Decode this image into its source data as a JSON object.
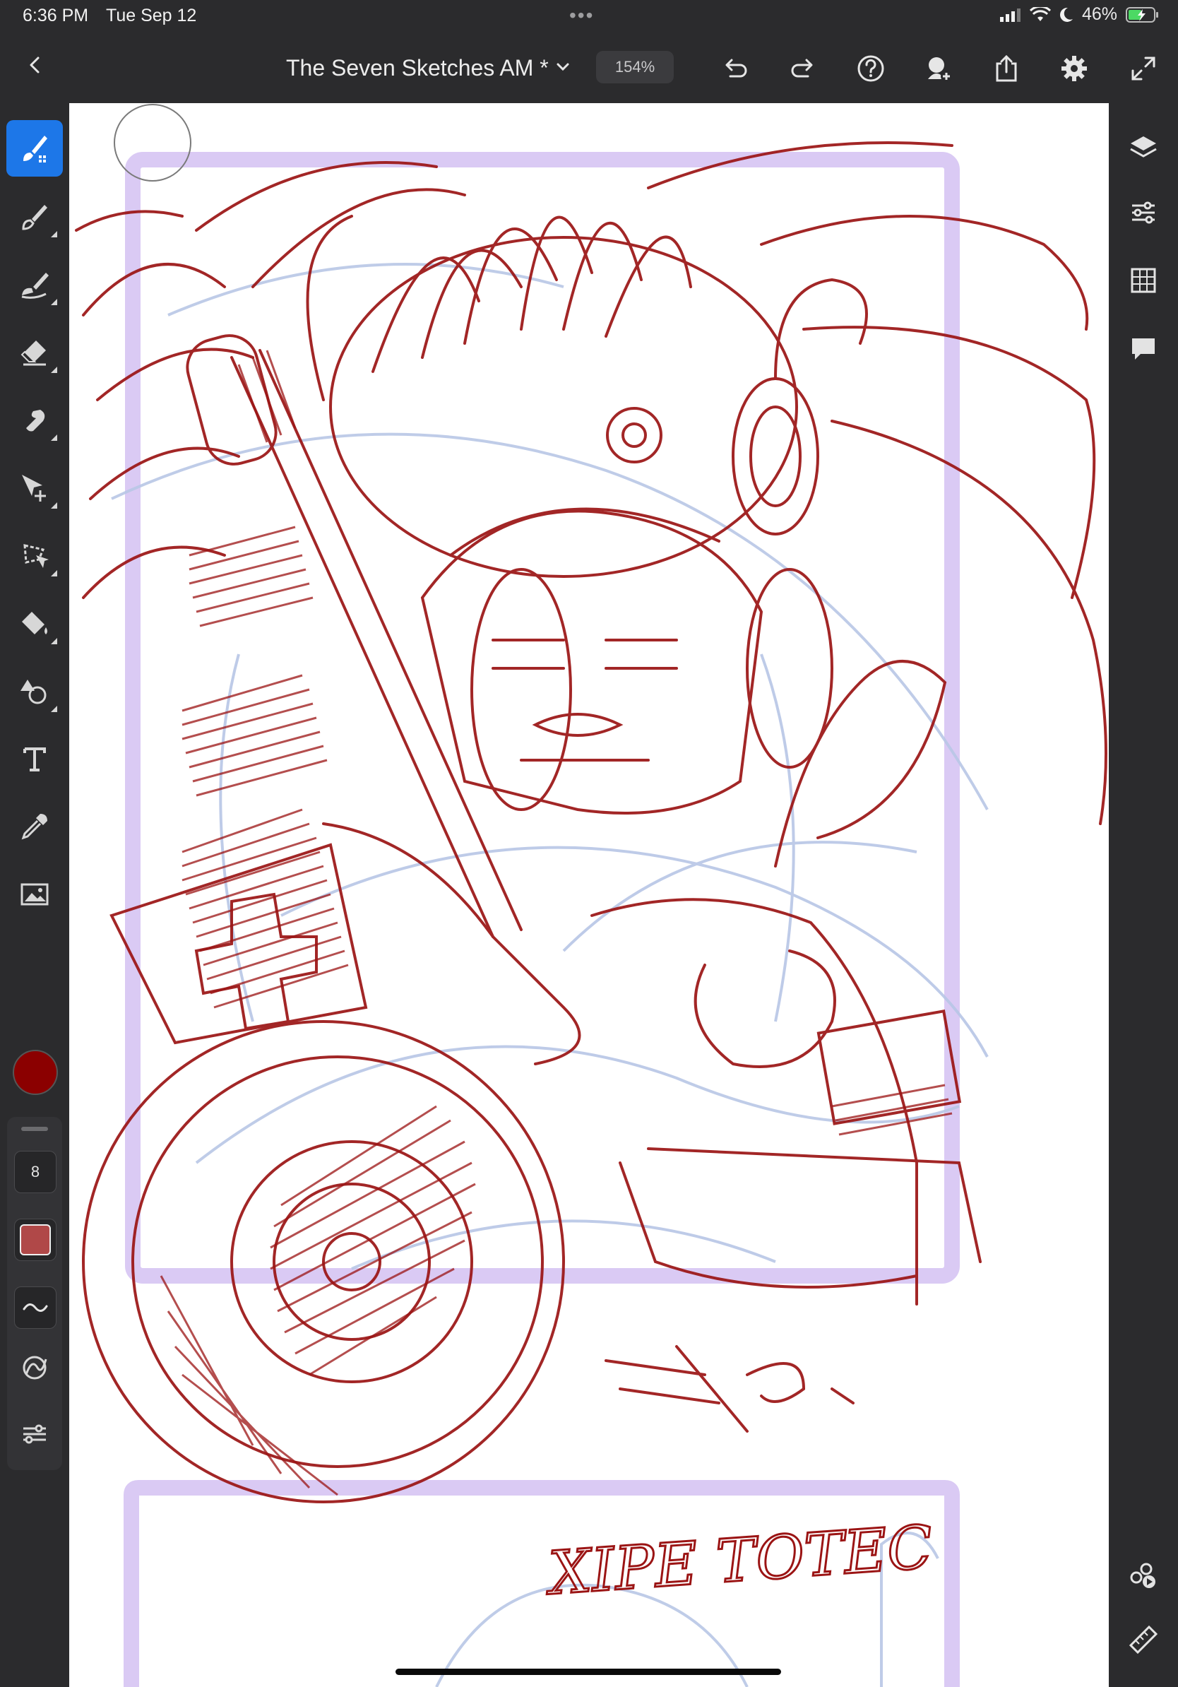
{
  "status_bar": {
    "time": "6:36 PM",
    "date": "Tue Sep 12",
    "more": "•••",
    "battery": "46%"
  },
  "toolbar": {
    "document_title": "The Seven Sketches AM *",
    "zoom_level": "154%"
  },
  "left_tools": [
    {
      "name": "pixel-brush",
      "active": true
    },
    {
      "name": "paint-brush"
    },
    {
      "name": "vector-brush"
    },
    {
      "name": "eraser"
    },
    {
      "name": "smudge"
    },
    {
      "name": "transform"
    },
    {
      "name": "lasso-selection"
    },
    {
      "name": "fill"
    },
    {
      "name": "shapes"
    },
    {
      "name": "text"
    },
    {
      "name": "eyedropper"
    },
    {
      "name": "image"
    }
  ],
  "brush_panel": {
    "current_color": "#8b0000",
    "brush_size": "8",
    "flow_color": "#b04848"
  },
  "right_panel": [
    {
      "name": "layers"
    },
    {
      "name": "layer-properties"
    },
    {
      "name": "grid"
    },
    {
      "name": "comments"
    },
    {
      "name": "invite"
    },
    {
      "name": "ruler"
    }
  ],
  "canvas": {
    "sketch_signature": "XIPE TOTEC",
    "ink_color": "#9b1414",
    "guide_color": "#c8b6ee",
    "blue_pencil_color": "#b8c6e6"
  }
}
